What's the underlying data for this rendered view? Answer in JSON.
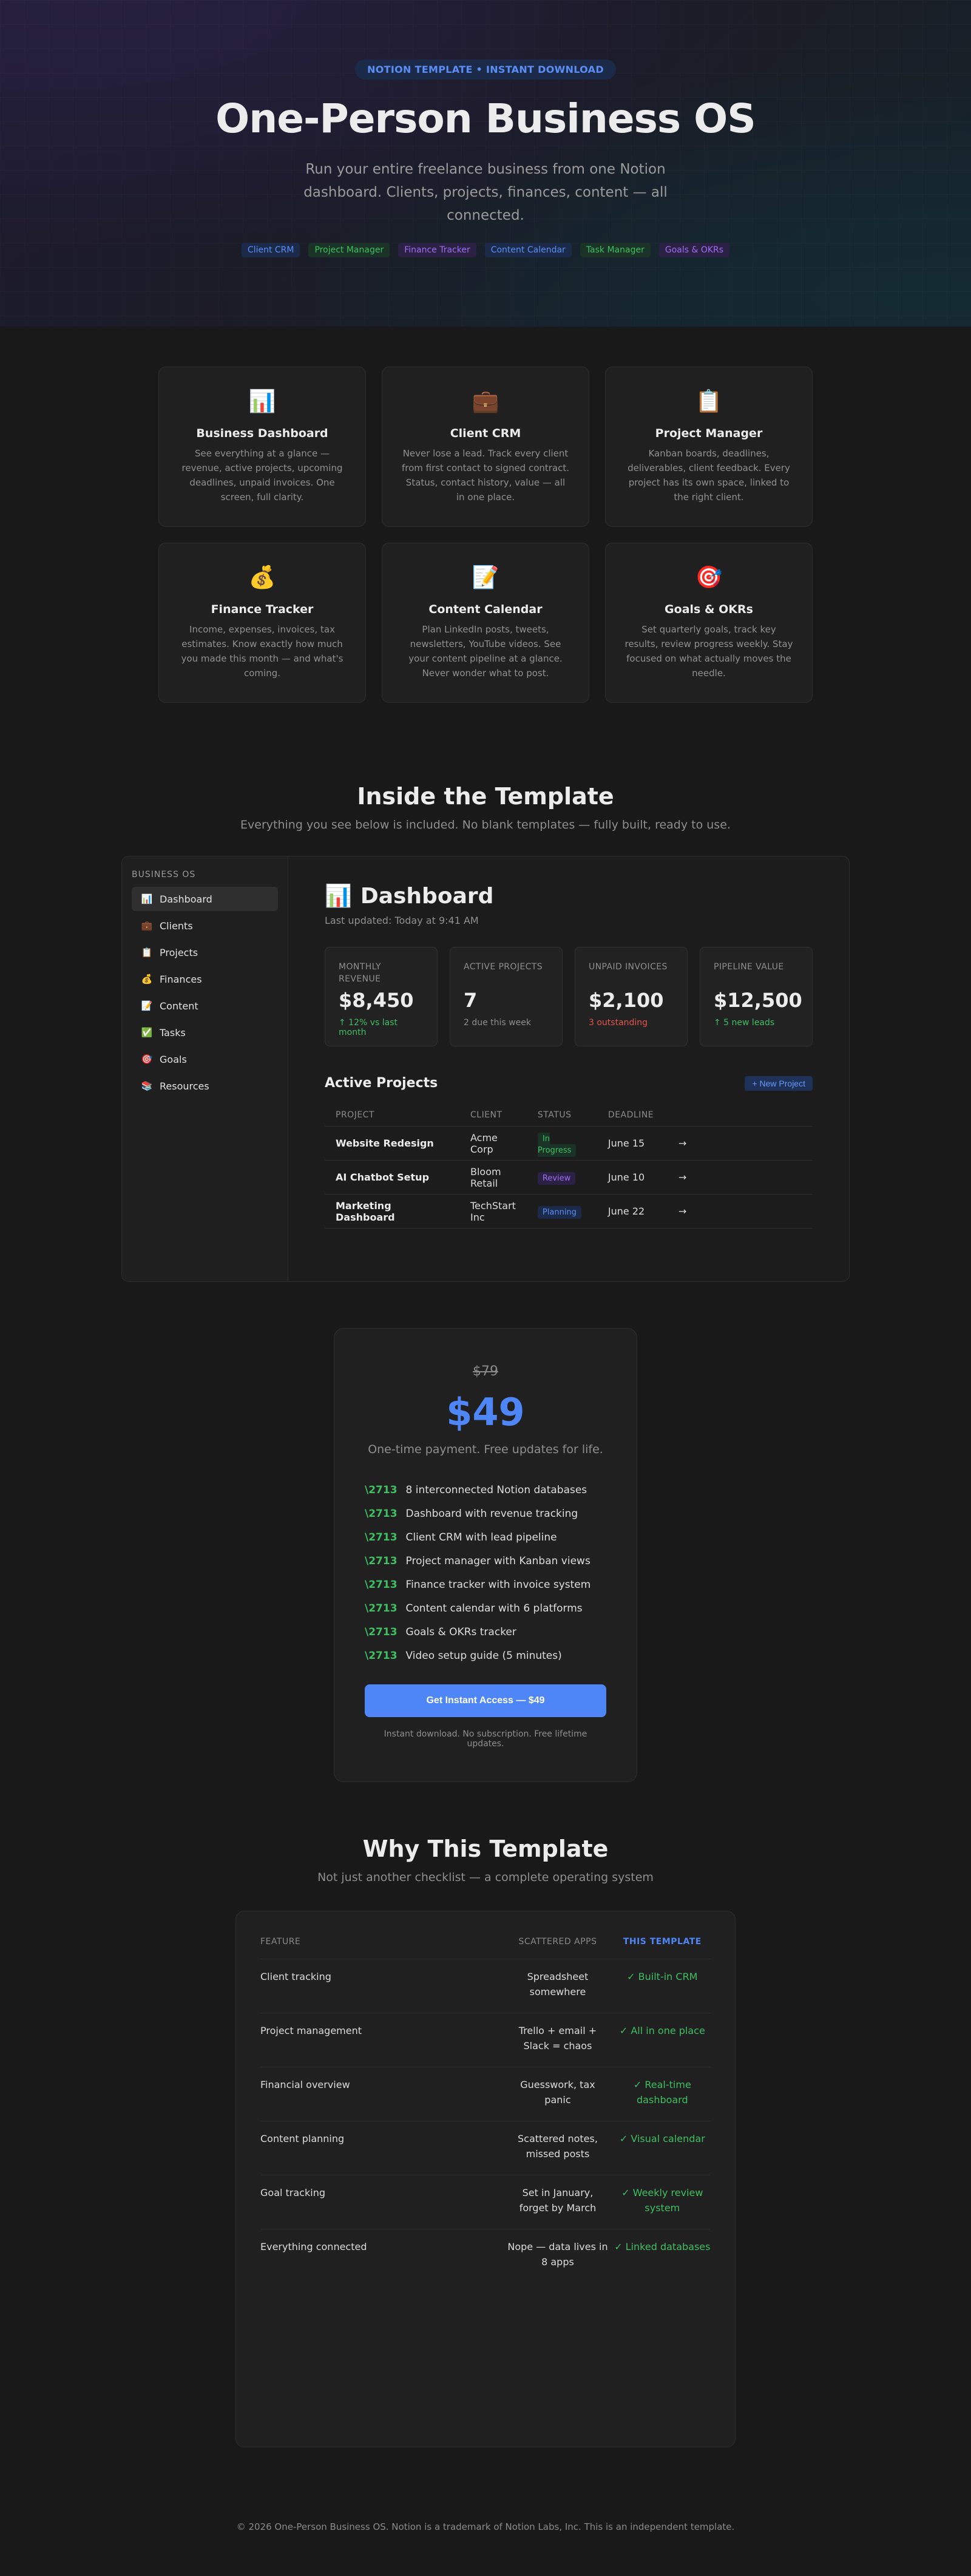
{
  "hero": {
    "badge": "NOTION TEMPLATE • INSTANT DOWNLOAD",
    "title": "One-Person Business OS",
    "subtitle": "Run your entire freelance business from one Notion dashboard. Clients, projects, finances, content — all connected.",
    "tags": [
      {
        "label": "Client CRM",
        "color": "#5b8ef5",
        "bg": "#1c2a4a"
      },
      {
        "label": "Project Manager",
        "color": "#3fbf62",
        "bg": "#1b3326"
      },
      {
        "label": "Finance Tracker",
        "color": "#a06cf0",
        "bg": "#2b2145"
      },
      {
        "label": "Content Calendar",
        "color": "#5b8ef5",
        "bg": "#1c2a4a"
      },
      {
        "label": "Task Manager",
        "color": "#3fbf62",
        "bg": "#1b3326"
      },
      {
        "label": "Goals & OKRs",
        "color": "#a06cf0",
        "bg": "#2b2145"
      }
    ]
  },
  "features": [
    {
      "icon": "📊",
      "icon_name": "bar-chart-icon",
      "title": "Business Dashboard",
      "desc": "See everything at a glance — revenue, active projects, upcoming deadlines, unpaid invoices. One screen, full clarity."
    },
    {
      "icon": "💼",
      "icon_name": "briefcase-icon",
      "title": "Client CRM",
      "desc": "Never lose a lead. Track every client from first contact to signed contract. Status, contact history, value — all in one place."
    },
    {
      "icon": "📋",
      "icon_name": "clipboard-icon",
      "title": "Project Manager",
      "desc": "Kanban boards, deadlines, deliverables, client feedback. Every project has its own space, linked to the right client."
    },
    {
      "icon": "💰",
      "icon_name": "money-bag-icon",
      "title": "Finance Tracker",
      "desc": "Income, expenses, invoices, tax estimates. Know exactly how much you made this month — and what's coming."
    },
    {
      "icon": "📝",
      "icon_name": "memo-icon",
      "title": "Content Calendar",
      "desc": "Plan LinkedIn posts, tweets, newsletters, YouTube videos. See your content pipeline at a glance. Never wonder what to post."
    },
    {
      "icon": "🎯",
      "icon_name": "target-icon",
      "title": "Goals & OKRs",
      "desc": "Set quarterly goals, track key results, review progress weekly. Stay focused on what actually moves the needle."
    }
  ],
  "inside": {
    "title": "Inside the Template",
    "subtitle": "Everything you see below is included. No blank templates — fully built, ready to use."
  },
  "sidebar": {
    "heading": "BUSINESS OS",
    "items": [
      {
        "icon": "📊",
        "icon_name": "bar-chart-icon",
        "label": "Dashboard",
        "active": true
      },
      {
        "icon": "💼",
        "icon_name": "briefcase-icon",
        "label": "Clients",
        "active": false
      },
      {
        "icon": "📋",
        "icon_name": "clipboard-icon",
        "label": "Projects",
        "active": false
      },
      {
        "icon": "💰",
        "icon_name": "money-bag-icon",
        "label": "Finances",
        "active": false
      },
      {
        "icon": "📝",
        "icon_name": "memo-icon",
        "label": "Content",
        "active": false
      },
      {
        "icon": "✅",
        "icon_name": "check-box-icon",
        "label": "Tasks",
        "active": false
      },
      {
        "icon": "🎯",
        "icon_name": "target-icon",
        "label": "Goals",
        "active": false
      },
      {
        "icon": "📚",
        "icon_name": "books-icon",
        "label": "Resources",
        "active": false
      }
    ]
  },
  "dashboard": {
    "icon": "📊",
    "title": "Dashboard",
    "updated": "Last updated: Today at 9:41 AM",
    "stats": [
      {
        "label": "MONTHLY REVENUE",
        "value": "$8,450",
        "note": "↑ 12% vs last month",
        "note_color": "#3fbf62"
      },
      {
        "label": "ACTIVE PROJECTS",
        "value": "7",
        "note": "2 due this week",
        "note_color": "#8e8e8e"
      },
      {
        "label": "UNPAID INVOICES",
        "value": "$2,100",
        "note": "3 outstanding",
        "note_color": "#e5534b"
      },
      {
        "label": "PIPELINE VALUE",
        "value": "$12,500",
        "note": "↑ 5 new leads",
        "note_color": "#3fbf62"
      }
    ],
    "projects_title": "Active Projects",
    "new_project_label": "+ New Project",
    "columns": [
      "PROJECT",
      "CLIENT",
      "STATUS",
      "DEADLINE"
    ],
    "rows": [
      {
        "project": "Website Redesign",
        "client": "Acme Corp",
        "status": "In Progress",
        "status_color": "#3fbf62",
        "status_bg": "#1b3326",
        "deadline": "June 15",
        "arrow": "→"
      },
      {
        "project": "AI Chatbot Setup",
        "client": "Bloom Retail",
        "status": "Review",
        "status_color": "#a06cf0",
        "status_bg": "#2b2145",
        "deadline": "June 10",
        "arrow": "→"
      },
      {
        "project": "Marketing Dashboard",
        "client": "TechStart Inc",
        "status": "Planning",
        "status_color": "#5b8ef5",
        "status_bg": "#1c2a4a",
        "deadline": "June 22",
        "arrow": "→"
      }
    ]
  },
  "pricing": {
    "old_price": "$79",
    "price": "$49",
    "note": "One-time payment. Free updates for life.",
    "check_mark": "\\2713",
    "items": [
      "8 interconnected Notion databases",
      "Dashboard with revenue tracking",
      "Client CRM with lead pipeline",
      "Project manager with Kanban views",
      "Finance tracker with invoice system",
      "Content calendar with 6 platforms",
      "Goals & OKRs tracker",
      "Video setup guide (5 minutes)"
    ],
    "cta": "Get Instant Access — $49",
    "cta_note": "Instant download. No subscription. Free lifetime updates."
  },
  "why": {
    "title": "Why This Template",
    "subtitle": "Not just another checklist — a complete operating system",
    "columns": [
      "FEATURE",
      "SCATTERED APPS",
      "THIS TEMPLATE"
    ],
    "rows": [
      {
        "feature": "Client tracking",
        "scattered": "Spreadsheet somewhere",
        "template": "✓ Built-in CRM"
      },
      {
        "feature": "Project management",
        "scattered": "Trello + email + Slack = chaos",
        "template": "✓ All in one place"
      },
      {
        "feature": "Financial overview",
        "scattered": "Guesswork, tax panic",
        "template": "✓ Real-time dashboard"
      },
      {
        "feature": "Content planning",
        "scattered": "Scattered notes, missed posts",
        "template": "✓ Visual calendar"
      },
      {
        "feature": "Goal tracking",
        "scattered": "Set in January, forget by March",
        "template": "✓ Weekly review system"
      },
      {
        "feature": "Everything connected",
        "scattered": "Nope — data lives in 8 apps",
        "template": "✓ Linked databases"
      }
    ]
  },
  "footer": "© 2026 One-Person Business OS. Notion is a trademark of Notion Labs, Inc. This is an independent template."
}
